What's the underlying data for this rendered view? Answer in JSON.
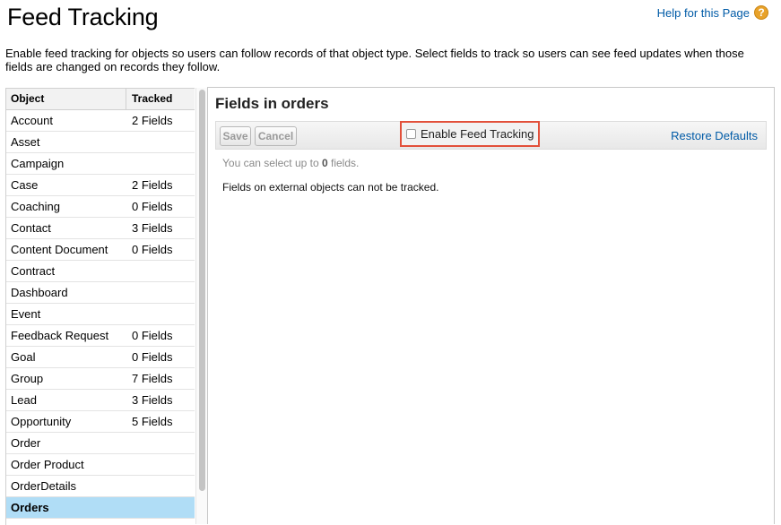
{
  "header": {
    "title": "Feed Tracking",
    "help_label": "Help for this Page",
    "help_icon": "question-circle-icon"
  },
  "description": "Enable feed tracking for objects so users can follow records of that object type. Select fields to track so users can see feed updates when those fields are changed on records they follow.",
  "object_list": {
    "columns": [
      "Object",
      "Tracked"
    ],
    "rows": [
      {
        "object": "Account",
        "tracked": "2 Fields"
      },
      {
        "object": "Asset",
        "tracked": ""
      },
      {
        "object": "Campaign",
        "tracked": ""
      },
      {
        "object": "Case",
        "tracked": "2 Fields"
      },
      {
        "object": "Coaching",
        "tracked": "0 Fields"
      },
      {
        "object": "Contact",
        "tracked": "3 Fields"
      },
      {
        "object": "Content Document",
        "tracked": "0 Fields"
      },
      {
        "object": "Contract",
        "tracked": ""
      },
      {
        "object": "Dashboard",
        "tracked": ""
      },
      {
        "object": "Event",
        "tracked": ""
      },
      {
        "object": "Feedback Request",
        "tracked": "0 Fields"
      },
      {
        "object": "Goal",
        "tracked": "0 Fields"
      },
      {
        "object": "Group",
        "tracked": "7 Fields"
      },
      {
        "object": "Lead",
        "tracked": "3 Fields"
      },
      {
        "object": "Opportunity",
        "tracked": "5 Fields"
      },
      {
        "object": "Order",
        "tracked": ""
      },
      {
        "object": "Order Product",
        "tracked": ""
      },
      {
        "object": "OrderDetails",
        "tracked": ""
      },
      {
        "object": "Orders",
        "tracked": "",
        "selected": true
      }
    ]
  },
  "fields_panel": {
    "title": "Fields in orders",
    "save_label": "Save",
    "cancel_label": "Cancel",
    "enable_label": "Enable Feed Tracking",
    "enable_checked": false,
    "restore_label": "Restore Defaults",
    "limit_prefix": "You can select up to ",
    "limit_count": "0",
    "limit_suffix": " fields.",
    "external_note": "Fields on external objects can not be tracked."
  },
  "colors": {
    "link": "#015ba7",
    "selected_row": "#b0ddf6",
    "highlight_border": "#e2503a"
  }
}
